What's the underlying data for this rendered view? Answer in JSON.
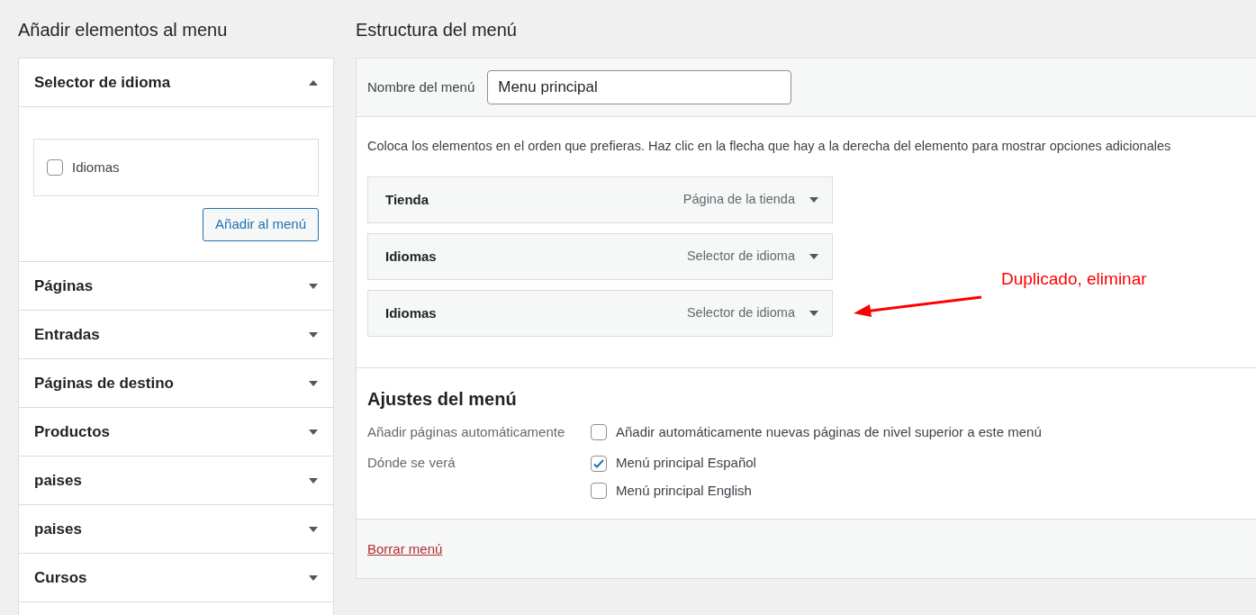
{
  "left": {
    "title": "Añadir elementos al menu",
    "sections": [
      {
        "label": "Selector de idioma",
        "expanded": true,
        "options": [
          {
            "label": "Idiomas",
            "checked": false
          }
        ],
        "button": "Añadir al menú"
      },
      {
        "label": "Páginas",
        "expanded": false
      },
      {
        "label": "Entradas",
        "expanded": false
      },
      {
        "label": "Páginas de destino",
        "expanded": false
      },
      {
        "label": "Productos",
        "expanded": false
      },
      {
        "label": "paises",
        "expanded": false
      },
      {
        "label": "paises",
        "expanded": false
      },
      {
        "label": "Cursos",
        "expanded": false
      }
    ]
  },
  "right": {
    "title": "Estructura del menú",
    "name_label": "Nombre del menú",
    "name_value": "Menu principal",
    "instructions": "Coloca los elementos en el orden que prefieras. Haz clic en la flecha que hay a la derecha del elemento para mostrar opciones adicionales",
    "items": [
      {
        "title": "Tienda",
        "type": "Página de la tienda"
      },
      {
        "title": "Idiomas",
        "type": "Selector de idioma"
      },
      {
        "title": "Idiomas",
        "type": "Selector de idioma"
      }
    ],
    "annotation": {
      "text": "Duplicado, eliminar"
    },
    "settings_title": "Ajustes del menú",
    "settings": [
      {
        "label": "Añadir páginas automáticamente",
        "options": [
          {
            "label": "Añadir automáticamente nuevas páginas de nivel superior a este menú",
            "checked": false
          }
        ]
      },
      {
        "label": "Dónde se verá",
        "options": [
          {
            "label": "Menú principal Español",
            "checked": true
          },
          {
            "label": "Menú principal English",
            "checked": false
          }
        ]
      }
    ],
    "delete_link": "Borrar menú"
  }
}
